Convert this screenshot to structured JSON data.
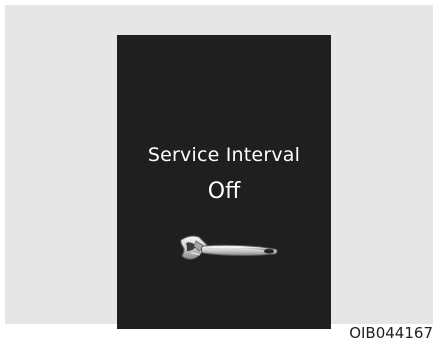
{
  "display": {
    "title": "Service Interval",
    "status": "Off",
    "icon": "wrench-icon",
    "background_color": "#1f1f1f",
    "text_color": "#ffffff"
  },
  "caption": "OIB044167",
  "frame_background_color": "#e6e6e6"
}
